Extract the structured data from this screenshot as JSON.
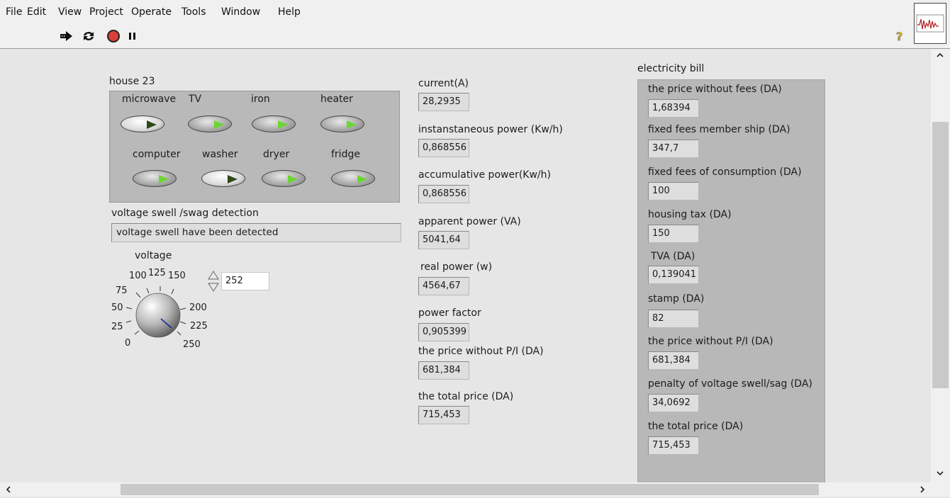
{
  "menu": [
    "File",
    "Edit",
    "View",
    "Project",
    "Operate",
    "Tools",
    "Window",
    "Help"
  ],
  "toolbar": {
    "run": "run-arrow-icon",
    "run_continuous": "run-continuously-icon",
    "abort": "abort-icon",
    "pause": "pause-icon",
    "help": "context-help-icon"
  },
  "house": {
    "title": "house 23",
    "appliances": [
      {
        "label": "microwave",
        "on": false
      },
      {
        "label": "TV",
        "on": true
      },
      {
        "label": "iron",
        "on": true
      },
      {
        "label": "heater",
        "on": true
      },
      {
        "label": "computer",
        "on": true
      },
      {
        "label": "washer",
        "on": false
      },
      {
        "label": "dryer",
        "on": true
      },
      {
        "label": "fridge",
        "on": true
      }
    ]
  },
  "swell": {
    "label": "voltage swell /swag detection",
    "value": "voltage swell have been detected"
  },
  "voltage": {
    "label": "voltage",
    "value": "252",
    "ticks": [
      "0",
      "25",
      "50",
      "75",
      "100",
      "125",
      "150",
      "200",
      "225",
      "250"
    ]
  },
  "measurements": [
    {
      "label": "current(A)",
      "value": "28,2935"
    },
    {
      "label": "instanstaneous power (Kw/h)",
      "value": "0,868556"
    },
    {
      "label": "accumulative power(Kw/h)",
      "value": "0,868556"
    },
    {
      "label": "apparent power (VA)",
      "value": "5041,64"
    },
    {
      "label": "real power (w)",
      "value": "4564,67"
    },
    {
      "label": "power factor",
      "value": "0,905399"
    },
    {
      "label": "the price without P/I (DA)",
      "value": "681,384"
    },
    {
      "label": "the total price (DA)",
      "value": "715,453"
    }
  ],
  "bill": {
    "title": "electricity bill",
    "items": [
      {
        "label": "the price without fees  (DA)",
        "value": "1,68394"
      },
      {
        "label": "fixed fees member ship (DA)",
        "value": "347,7"
      },
      {
        "label": "fixed fees of consumption (DA)",
        "value": "100"
      },
      {
        "label": "housing tax (DA)",
        "value": "150"
      },
      {
        "label": "TVA (DA)",
        "value": "0,139041"
      },
      {
        "label": "stamp (DA)",
        "value": "82"
      },
      {
        "label": "the price without P/I (DA)",
        "value": "681,384"
      },
      {
        "label": "penalty of voltage swell/sag (DA)",
        "value": "34,0692"
      },
      {
        "label": "the total price (DA)",
        "value": "715,453"
      }
    ]
  },
  "colors": {
    "led_on": "#6cd634",
    "led_off": "#2d4a18",
    "panel": "#e6e6e6",
    "cluster": "#b9b9b9"
  }
}
